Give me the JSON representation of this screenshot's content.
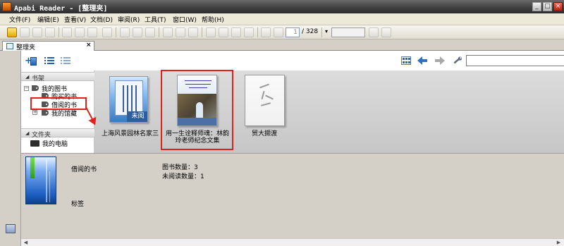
{
  "window": {
    "title": "Apabi Reader - [整理夹]"
  },
  "menu": [
    "文件(F)",
    "编辑(E)",
    "查看(V)",
    "文档(D)",
    "审阅(R)",
    "工具(T)",
    "窗口(W)",
    "帮助(H)"
  ],
  "toolbar": {
    "page_value": "1",
    "page_total": "/ 328"
  },
  "tab": {
    "label": "整理夹",
    "close": "×"
  },
  "sidebar": {
    "shelf_header": "书架",
    "tree": [
      {
        "label": "我的图书",
        "expander": "−"
      },
      {
        "label": "购买的书"
      },
      {
        "label": "借阅的书"
      },
      {
        "label": "我的馆藏",
        "expander": "+"
      }
    ],
    "folder_header": "文件夹",
    "folders": [
      {
        "label": "我的电脑"
      }
    ]
  },
  "books": [
    {
      "title": "上海风景园林名家三",
      "badge": "未阅"
    },
    {
      "title_line1": "用一生诠释师魂：林韵",
      "title_line2": "玲老师纪念文集"
    },
    {
      "title": "贸大撷渡"
    }
  ],
  "details": {
    "name": "借阅的书",
    "tag_label": "标签",
    "book_count": "图书数量：3",
    "unread_count": "未阅读数量：1"
  },
  "colors": {
    "accent": "#1d5fb4",
    "highlight": "#e0221c"
  }
}
